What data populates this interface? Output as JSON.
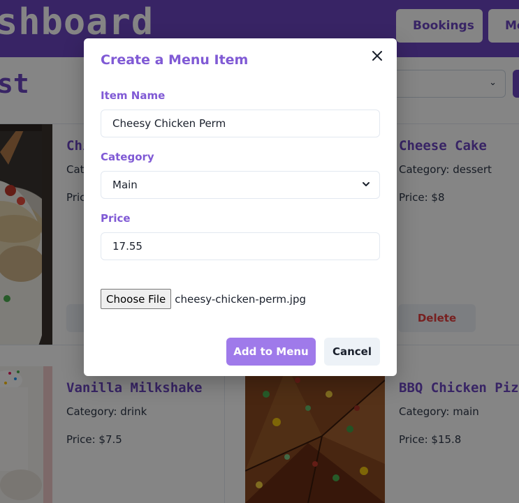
{
  "header": {
    "brand": "shboard",
    "nav": {
      "bookings_label": "Bookings",
      "menu_label": "Me"
    }
  },
  "subheader": {
    "title": "st"
  },
  "cards": [
    {
      "title": "Chi",
      "category": "Cate",
      "price": "Pric",
      "image": "chicken-dish-image"
    },
    {
      "title": "Cheese Cake",
      "category": "Category: dessert",
      "price": "Price: $8",
      "delete_label": "Delete"
    },
    {
      "title": "Vanilla Milkshake",
      "category": "Category: drink",
      "price": "Price: $7.5",
      "image": "milkshake-image"
    },
    {
      "title": "BBQ Chicken Pizz",
      "category": "Category: main",
      "price": "Price: $15.8",
      "image": "pizza-image"
    }
  ],
  "modal": {
    "title": "Create a Menu Item",
    "close_icon": "close-icon",
    "item_name": {
      "label": "Item Name",
      "value": "Cheesy Chicken Perm"
    },
    "category": {
      "label": "Category",
      "value": "Main"
    },
    "price": {
      "label": "Price",
      "value": "17.55"
    },
    "file": {
      "button_label": "Choose File",
      "filename": "cheesy-chicken-perm.jpg"
    },
    "add_label": "Add to Menu",
    "cancel_label": "Cancel"
  },
  "colors": {
    "brand_purple": "#6b46c1",
    "accent_purple": "#805ad5",
    "add_button": "#9f7aea",
    "delete_text": "#e53e3e"
  }
}
